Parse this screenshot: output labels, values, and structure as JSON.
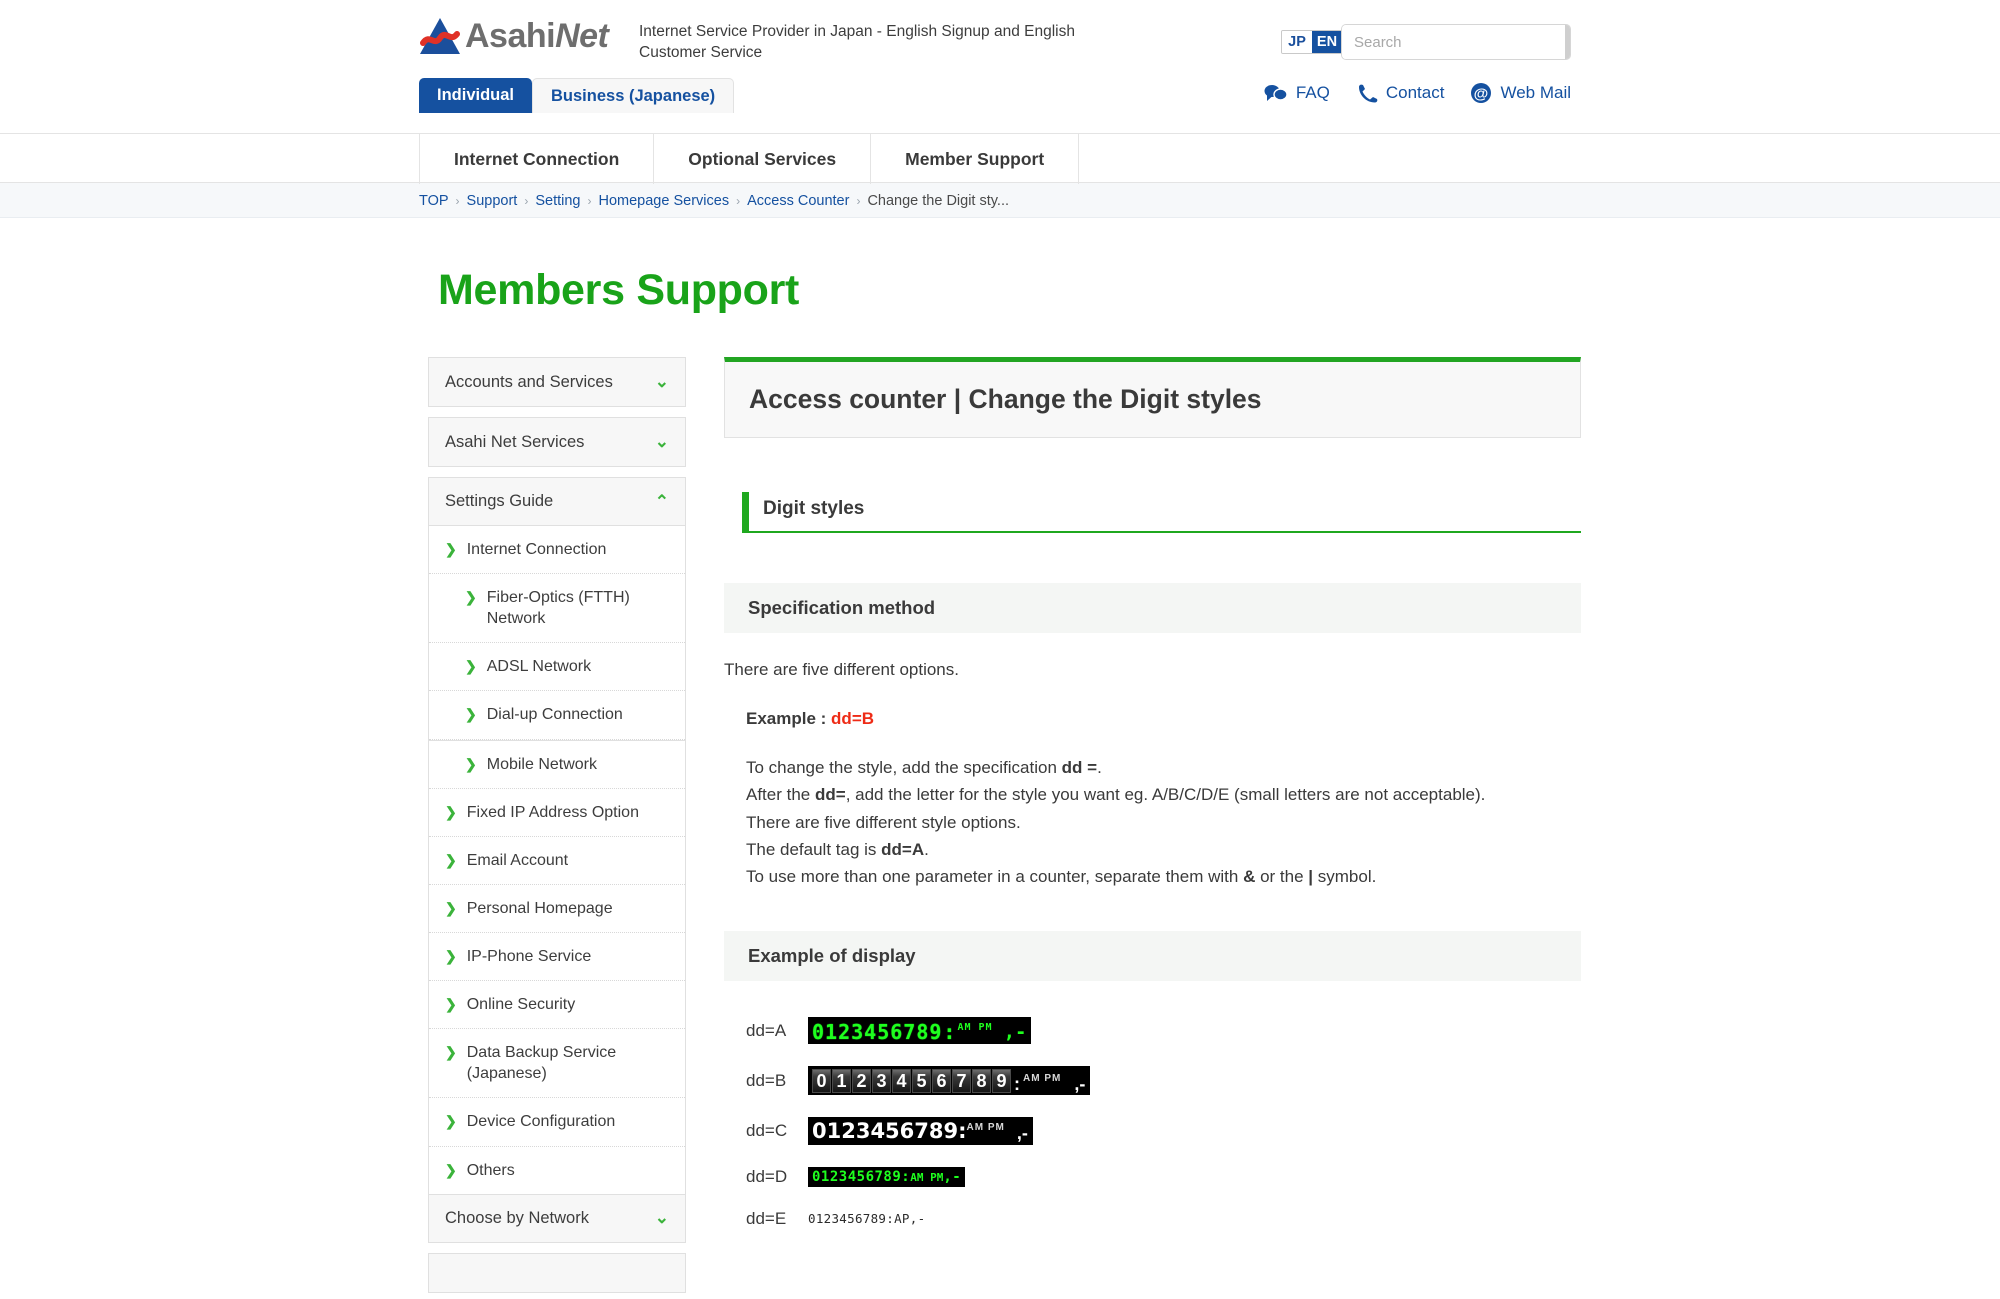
{
  "header": {
    "logo_text_main": "Asahi",
    "logo_text_accent": "Net",
    "logo_icon": "asahi-net-triangle-logo",
    "tagline": "Internet Service Provider in Japan - English Signup and English Customer Service",
    "lang": {
      "jp": "JP",
      "en": "EN",
      "active": "EN"
    },
    "search": {
      "placeholder": "Search",
      "value": "",
      "button_icon": "search-icon"
    },
    "tabs": [
      {
        "label": "Individual",
        "active": true
      },
      {
        "label": "Business (Japanese)",
        "active": false
      }
    ],
    "quicklinks": [
      {
        "label": "FAQ",
        "icon": "chat-bubbles-icon"
      },
      {
        "label": "Contact",
        "icon": "phone-icon"
      },
      {
        "label": "Web Mail",
        "icon": "at-sign-icon"
      }
    ]
  },
  "mainnav": {
    "items": [
      {
        "label": "Internet Connection"
      },
      {
        "label": "Optional Services"
      },
      {
        "label": "Member Support"
      }
    ]
  },
  "breadcrumb": {
    "items": [
      {
        "label": "TOP",
        "link": true
      },
      {
        "label": "Support",
        "link": true
      },
      {
        "label": "Setting",
        "link": true
      },
      {
        "label": "Homepage Services",
        "link": true
      },
      {
        "label": "Access Counter",
        "link": true
      },
      {
        "label": "Change the Digit sty...",
        "link": false
      }
    ],
    "separator": "›"
  },
  "page_title": "Members Support",
  "sidebar": {
    "panels": [
      {
        "label": "Accounts and Services",
        "state": "collapsed",
        "chevron": "chevron-down-icon"
      },
      {
        "label": "Asahi Net Services",
        "state": "collapsed",
        "chevron": "chevron-down-icon"
      },
      {
        "label": "Settings Guide",
        "state": "expanded",
        "chevron": "chevron-up-icon"
      }
    ],
    "settings_items": [
      {
        "label": "Internet Connection",
        "level": 1
      },
      {
        "label": "Fiber-Optics (FTTH) Network",
        "level": 2
      },
      {
        "label": "ADSL Network",
        "level": 2
      },
      {
        "label": "Dial-up Connection",
        "level": 2
      },
      {
        "label": "Mobile Network",
        "level": 2
      },
      {
        "label": "Fixed IP Address Option",
        "level": 1
      },
      {
        "label": "Email Account",
        "level": 1
      },
      {
        "label": "Personal Homepage",
        "level": 1
      },
      {
        "label": "IP-Phone Service",
        "level": 1
      },
      {
        "label": "Online Security",
        "level": 1
      },
      {
        "label": "Data Backup Service (Japanese)",
        "level": 1
      },
      {
        "label": "Device Configuration",
        "level": 1
      },
      {
        "label": "Others",
        "level": 1
      }
    ],
    "footer_panel": {
      "label": "Choose by Network",
      "chevron": "chevron-down-icon"
    }
  },
  "content": {
    "title": "Access counter | Change the Digit styles",
    "section_heading": "Digit styles",
    "subsection_spec": "Specification method",
    "intro": "There are five different options.",
    "example_label": "Example : ",
    "example_value": "dd=B",
    "lines": [
      "To change the style, add the specification ",
      "After the ",
      "There are five different style options.",
      "The default tag is ",
      "To use more than one parameter in a counter, separate them with "
    ],
    "line1_prefix": "To change the style, add the specification ",
    "line1_bold": "dd =",
    "line1_suffix": ".",
    "line2_prefix": "After the ",
    "line2_bold": "dd=",
    "line2_suffix": ", add the letter for the style you want eg. A/B/C/D/E (small letters are not acceptable).",
    "line3": "There are five different style options.",
    "line4_prefix": "The default tag is ",
    "line4_bold": "dd=A",
    "line4_suffix": ".",
    "line5_prefix": "To use more than one parameter in a counter, separate them with ",
    "line5_bold1": "&",
    "line5_mid": " or the ",
    "line5_bold2": "|",
    "line5_suffix": " symbol.",
    "subsection_example": "Example of display",
    "examples": [
      {
        "label": "dd=A",
        "style": "A",
        "digits": "0123456789",
        "colon": ":",
        "ampm": "AM PM",
        "tail": ",-"
      },
      {
        "label": "dd=B",
        "style": "B",
        "digits": "0123456789",
        "colon": ":",
        "ampm": "AM PM",
        "tail": ",-"
      },
      {
        "label": "dd=C",
        "style": "C",
        "digits": "0123456789",
        "colon": ":",
        "ampm": "AM PM",
        "tail": ",-"
      },
      {
        "label": "dd=D",
        "style": "D",
        "digits": "0123456789",
        "colon": ":",
        "ampm": "AM PM",
        "tail": ",-"
      },
      {
        "label": "dd=E",
        "style": "E",
        "digits": "0123456789",
        "colon": ":",
        "ampm": "AP",
        "tail": ",-"
      }
    ]
  },
  "colors": {
    "brand_blue": "#1551a0",
    "brand_green": "#19a319",
    "accent_green": "#3bb33b",
    "accent_red": "#ee2b16",
    "led_green": "#1eff1e"
  }
}
